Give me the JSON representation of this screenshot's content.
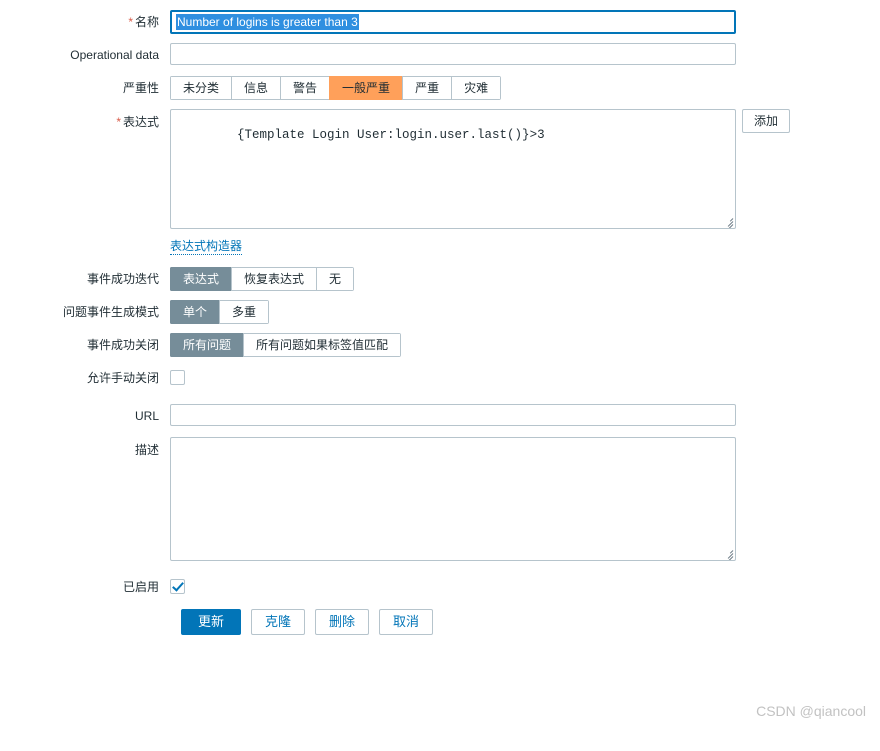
{
  "form": {
    "name_row": {
      "label": "名称",
      "required": true,
      "value": "Number of logins is greater than 3",
      "selected": true,
      "focused": true
    },
    "operational_data_row": {
      "label": "Operational data",
      "required": false,
      "value": "",
      "placeholder": ""
    },
    "severity_row": {
      "label": "严重性",
      "required": false,
      "options": [
        "未分类",
        "信息",
        "警告",
        "一般严重",
        "严重",
        "灾难"
      ],
      "selected": "一般严重",
      "selected_color": "#ffa05a"
    },
    "expression_row": {
      "label": "表达式",
      "required": true,
      "value": "{Template Login User:login.user.last()}>3",
      "add_button": "添加",
      "builder_link": "表达式构造器"
    },
    "ok_event_generation_row": {
      "label": "事件成功迭代",
      "options": [
        "表达式",
        "恢复表达式",
        "无"
      ],
      "selected": "表达式"
    },
    "problem_event_generation_row": {
      "label": "问题事件生成模式",
      "options": [
        "单个",
        "多重"
      ],
      "selected": "单个"
    },
    "ok_event_closes_row": {
      "label": "事件成功关闭",
      "options": [
        "所有问题",
        "所有问题如果标签值匹配"
      ],
      "selected": "所有问题"
    },
    "manual_close_row": {
      "label": "允许手动关闭",
      "checked": false
    },
    "url_row": {
      "label": "URL",
      "value": "",
      "placeholder": ""
    },
    "description_row": {
      "label": "描述",
      "value": "",
      "placeholder": ""
    },
    "enabled_row": {
      "label": "已启用",
      "checked": true
    }
  },
  "footer": {
    "update_label": "更新",
    "clone_label": "克隆",
    "delete_label": "删除",
    "cancel_label": "取消"
  },
  "watermark": {
    "text": "CSDN @qiancool"
  },
  "colors": {
    "accent": "#0275b8",
    "severity_selected": "#ffa05a",
    "segment_selected": "#768d99",
    "required_star": "#d95c4a",
    "border": "#b6c4cc"
  }
}
